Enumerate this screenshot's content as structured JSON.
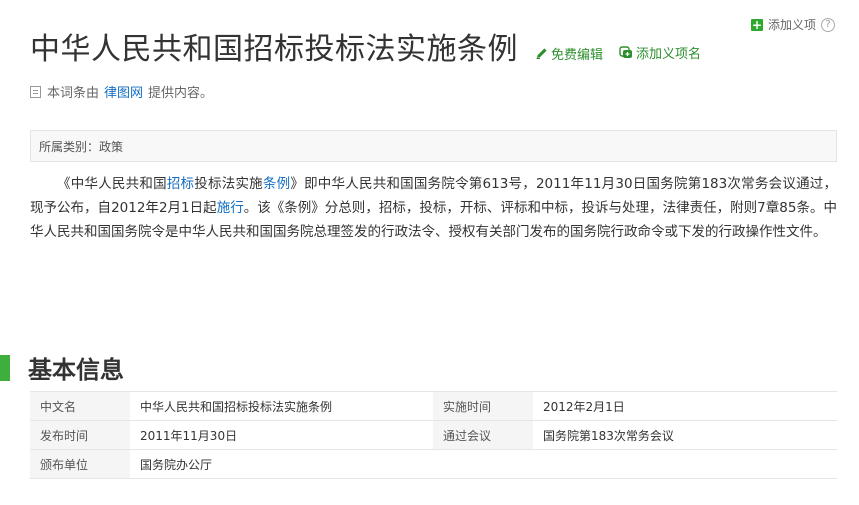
{
  "header": {
    "title": "中华人民共和国招标投标法实施条例",
    "edit_label": "免费编辑",
    "add_sense_label": "添加义项名",
    "top_add_label": "添加义项",
    "help_glyph": "?",
    "plus_glyph": "+"
  },
  "source": {
    "prefix": "本词条由",
    "link": "律图网",
    "suffix": "提供内容。"
  },
  "category": {
    "text": "所属类别：政策"
  },
  "summary": {
    "p1": "《中华人民共和国",
    "l1": "招标",
    "p2": "投标法实施",
    "l2": "条例",
    "p3": "》即中华人民共和国国务院令第613号，2011年11月30日国务院第183次常务会议通过，现予公布，自2012年2月1日起",
    "l3": "施行",
    "p4": "。该《条例》分总则，招标，投标，开标、评标和中标，投诉与处理，法律责任，附则7章85条。中华人民共和国国务院令是中华人民共和国国务院总理签发的行政法令、授权有关部门发布的国务院行政命令或下发的行政操作性文件。"
  },
  "basic_info": {
    "heading": "基本信息",
    "rows": [
      [
        {
          "k": "中文名",
          "v": "中华人民共和国招标投标法实施条例"
        },
        {
          "k": "实施时间",
          "v": "2012年2月1日"
        }
      ],
      [
        {
          "k": "发布时间",
          "v": "2011年11月30日"
        },
        {
          "k": "通过会议",
          "v": "国务院第183次常务会议"
        }
      ],
      [
        {
          "k": "颁布单位",
          "v": "国务院办公厅"
        },
        {
          "k": "",
          "v": ""
        }
      ]
    ]
  },
  "colors": {
    "accent_green": "#3eaf3e",
    "link_blue": "#136ec2"
  }
}
